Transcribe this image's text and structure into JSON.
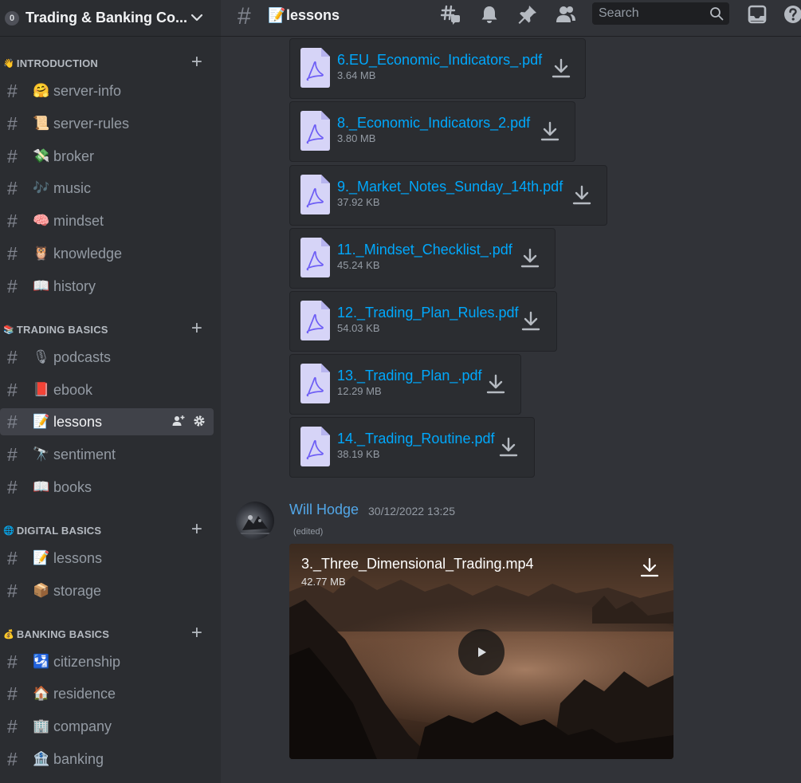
{
  "server": {
    "name": "Trading & Banking Co...",
    "icon_text": "0"
  },
  "sidebar": {
    "categories": [
      {
        "emoji": "👋",
        "name": "INTRODUCTION"
      },
      {
        "emoji": "📚",
        "name": "TRADING BASICS"
      },
      {
        "emoji": "🌐",
        "name": "DIGITAL BASICS"
      },
      {
        "emoji": "💰",
        "name": "BANKING BASICS"
      }
    ],
    "channels": [
      {
        "emoji": "🤗",
        "name": "server-info"
      },
      {
        "emoji": "📜",
        "name": "server-rules"
      },
      {
        "emoji": "💸",
        "name": "broker"
      },
      {
        "emoji": "🎶",
        "name": "music"
      },
      {
        "emoji": "🧠",
        "name": "mindset"
      },
      {
        "emoji": "🦉",
        "name": "knowledge"
      },
      {
        "emoji": "📖",
        "name": "history"
      },
      {
        "emoji": "🎙",
        "name": "podcasts"
      },
      {
        "emoji": "📕",
        "name": "ebook"
      },
      {
        "emoji": "📝",
        "name": "lessons"
      },
      {
        "emoji": "🔭",
        "name": "sentiment"
      },
      {
        "emoji": "📖",
        "name": "books"
      },
      {
        "emoji": "📝",
        "name": "lessons"
      },
      {
        "emoji": "📦",
        "name": "storage"
      },
      {
        "emoji": "🛂",
        "name": "citizenship"
      },
      {
        "emoji": "🏠",
        "name": "residence"
      },
      {
        "emoji": "🏢",
        "name": "company"
      },
      {
        "emoji": "🏦",
        "name": "banking"
      }
    ]
  },
  "topbar": {
    "channel_emoji": "📝",
    "channel_name": "lessons",
    "search_placeholder": "Search"
  },
  "attachments": [
    {
      "name": "6.EU_Economic_Indicators_.pdf",
      "size": "3.64 MB"
    },
    {
      "name": "8._Economic_Indicators_2.pdf",
      "size": "3.80 MB"
    },
    {
      "name": "9._Market_Notes_Sunday_14th.pdf",
      "size": "37.92 KB"
    },
    {
      "name": "11._Mindset_Checklist_.pdf",
      "size": "45.24 KB"
    },
    {
      "name": "12._Trading_Plan_Rules.pdf",
      "size": "54.03 KB"
    },
    {
      "name": "13._Trading_Plan_.pdf",
      "size": "12.29 MB"
    },
    {
      "name": "14._Trading_Routine.pdf",
      "size": "38.19 KB"
    }
  ],
  "message": {
    "author": "Will Hodge",
    "timestamp": "30/12/2022 13:25",
    "edited": "(edited)",
    "author_color": "#52a7e8"
  },
  "video": {
    "name": "3._Three_Dimensional_Trading.mp4",
    "size": "42.77 MB"
  },
  "colors": {
    "link": "#00a8fc",
    "sidebar_bg": "#2b2d31",
    "chat_bg": "#313338",
    "active_channel_bg": "#404249"
  }
}
